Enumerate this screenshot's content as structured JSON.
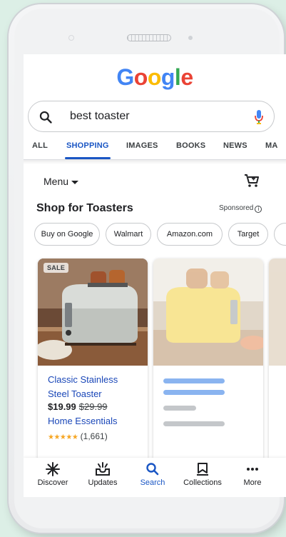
{
  "logo": {
    "letters": [
      "G",
      "o",
      "o",
      "g",
      "l",
      "e"
    ],
    "colors": [
      "#4285F4",
      "#EA4335",
      "#FBBC05",
      "#4285F4",
      "#34A853",
      "#EA4335"
    ]
  },
  "search": {
    "query": "best toaster"
  },
  "tabs": [
    {
      "label": "ALL"
    },
    {
      "label": "SHOPPING"
    },
    {
      "label": "IMAGES"
    },
    {
      "label": "BOOKS"
    },
    {
      "label": "NEWS"
    },
    {
      "label": "MA"
    }
  ],
  "active_tab": "SHOPPING",
  "menu_label": "Menu",
  "section": {
    "title": "Shop for Toasters",
    "sponsored": "Sponsored",
    "info_glyph": "i"
  },
  "chips": [
    "Buy on Google",
    "Walmart",
    "Amazon.com",
    "Target"
  ],
  "products": [
    {
      "badge": "SALE",
      "title": "Classic Stainless Steel Toaster",
      "price": "$19.99",
      "original_price": "$29.99",
      "store": "Home Essentials",
      "stars": "★★★★★",
      "rating_count": "(1,661)"
    }
  ],
  "bottom_nav": [
    {
      "label": "Discover",
      "icon": "asterisk-icon"
    },
    {
      "label": "Updates",
      "icon": "inbox-icon"
    },
    {
      "label": "Search",
      "icon": "search-icon"
    },
    {
      "label": "Collections",
      "icon": "bookmark-icon"
    },
    {
      "label": "More",
      "icon": "more-dots-icon"
    }
  ],
  "colors": {
    "accent": "#1a56c4",
    "link": "#1a47b8",
    "star": "#f6a623"
  }
}
